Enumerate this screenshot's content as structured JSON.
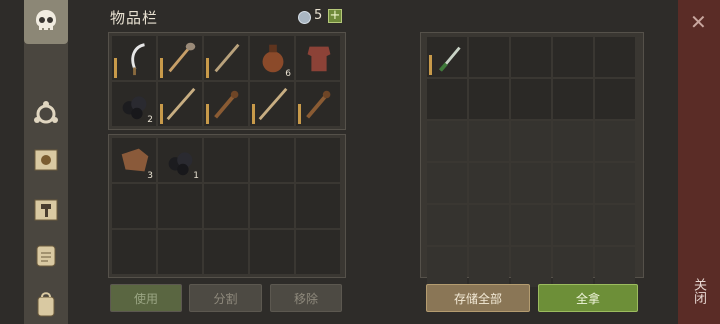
{
  "header": {
    "title": "物品栏",
    "gem_count": "5",
    "gem_plus": "+"
  },
  "sidebar": {
    "items": [
      {
        "icon": "skull-icon"
      },
      {
        "icon": "triskele-icon"
      },
      {
        "icon": "sun-book-icon"
      },
      {
        "icon": "hammer-map-icon"
      },
      {
        "icon": "scroll-icon"
      },
      {
        "icon": "backpack-icon"
      }
    ]
  },
  "inventory": {
    "quick": [
      {
        "icon": "sickle-icon",
        "qty": ""
      },
      {
        "icon": "shovel-icon",
        "qty": ""
      },
      {
        "icon": "sword-icon",
        "qty": ""
      },
      {
        "icon": "potion-icon",
        "qty": "6"
      },
      {
        "icon": "armor-icon",
        "qty": ""
      },
      {
        "icon": "coal-icon",
        "qty": "2"
      },
      {
        "icon": "spear-icon",
        "qty": ""
      },
      {
        "icon": "club-icon",
        "qty": ""
      },
      {
        "icon": "spear-icon",
        "qty": ""
      },
      {
        "icon": "club-icon",
        "qty": ""
      }
    ],
    "bag": [
      {
        "icon": "leather-icon",
        "qty": "3"
      },
      {
        "icon": "coal-icon",
        "qty": "1"
      }
    ],
    "buttons": {
      "use": "使用",
      "split": "分割",
      "remove": "移除"
    }
  },
  "storage": {
    "items": [
      {
        "icon": "dagger-icon",
        "qty": ""
      }
    ],
    "buttons": {
      "store_all": "存储全部",
      "take_all": "全拿"
    }
  },
  "close": {
    "icon": "close-icon",
    "label": "关闭"
  },
  "colors": {
    "accent_green": "#6d8f38",
    "accent_brown": "#8a7656",
    "close_red": "#5a2c26"
  }
}
